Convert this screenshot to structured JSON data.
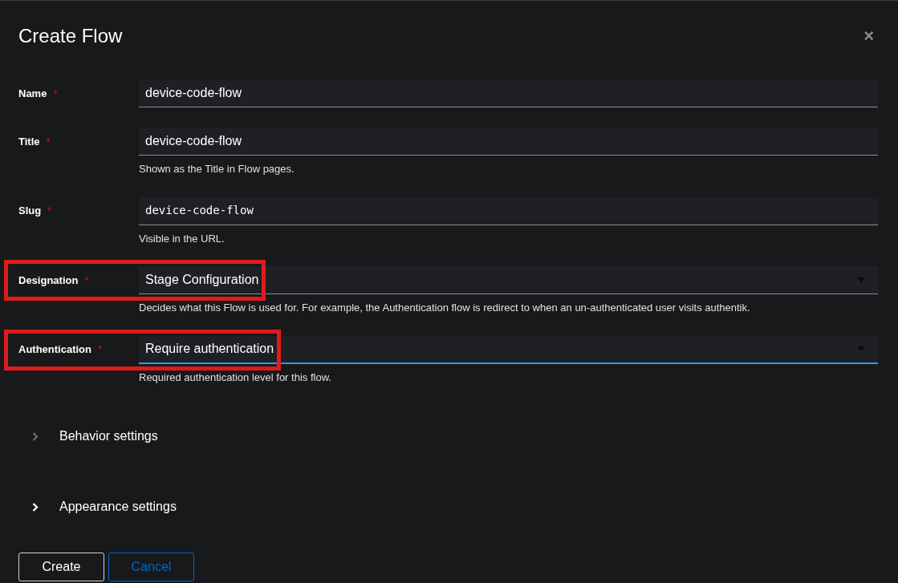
{
  "dialog": {
    "title": "Create Flow",
    "close": "×"
  },
  "fields": [
    {
      "label": "Name",
      "required": "*",
      "kind": "text",
      "value": "device-code-flow",
      "focused": false,
      "highlighted": false
    },
    {
      "label": "Title",
      "required": "*",
      "kind": "text",
      "value": "device-code-flow",
      "helper": "Shown as the Title in Flow pages.",
      "focused": false,
      "highlighted": false
    },
    {
      "label": "Slug",
      "required": "*",
      "kind": "mono",
      "value": "device-code-flow",
      "helper": "Visible in the URL.",
      "focused": false,
      "highlighted": false
    },
    {
      "label": "Designation",
      "required": "*",
      "kind": "select",
      "value": "Stage Configuration",
      "helper": "Decides what this Flow is used for. For example, the Authentication flow is redirect to when an un-authenticated user visits authentik.",
      "focused": false,
      "highlighted": true
    },
    {
      "label": "Authentication",
      "required": "*",
      "kind": "select",
      "value": "Require authentication",
      "helper": "Required authentication level for this flow.",
      "focused": true,
      "highlighted": true
    }
  ],
  "sections": [
    {
      "label": "Behavior settings",
      "dimmed": true
    },
    {
      "label": "Appearance settings",
      "dimmed": false
    }
  ],
  "buttons": [
    {
      "label": "Create",
      "kind": "primary"
    },
    {
      "label": "Cancel",
      "kind": "secondary"
    }
  ]
}
